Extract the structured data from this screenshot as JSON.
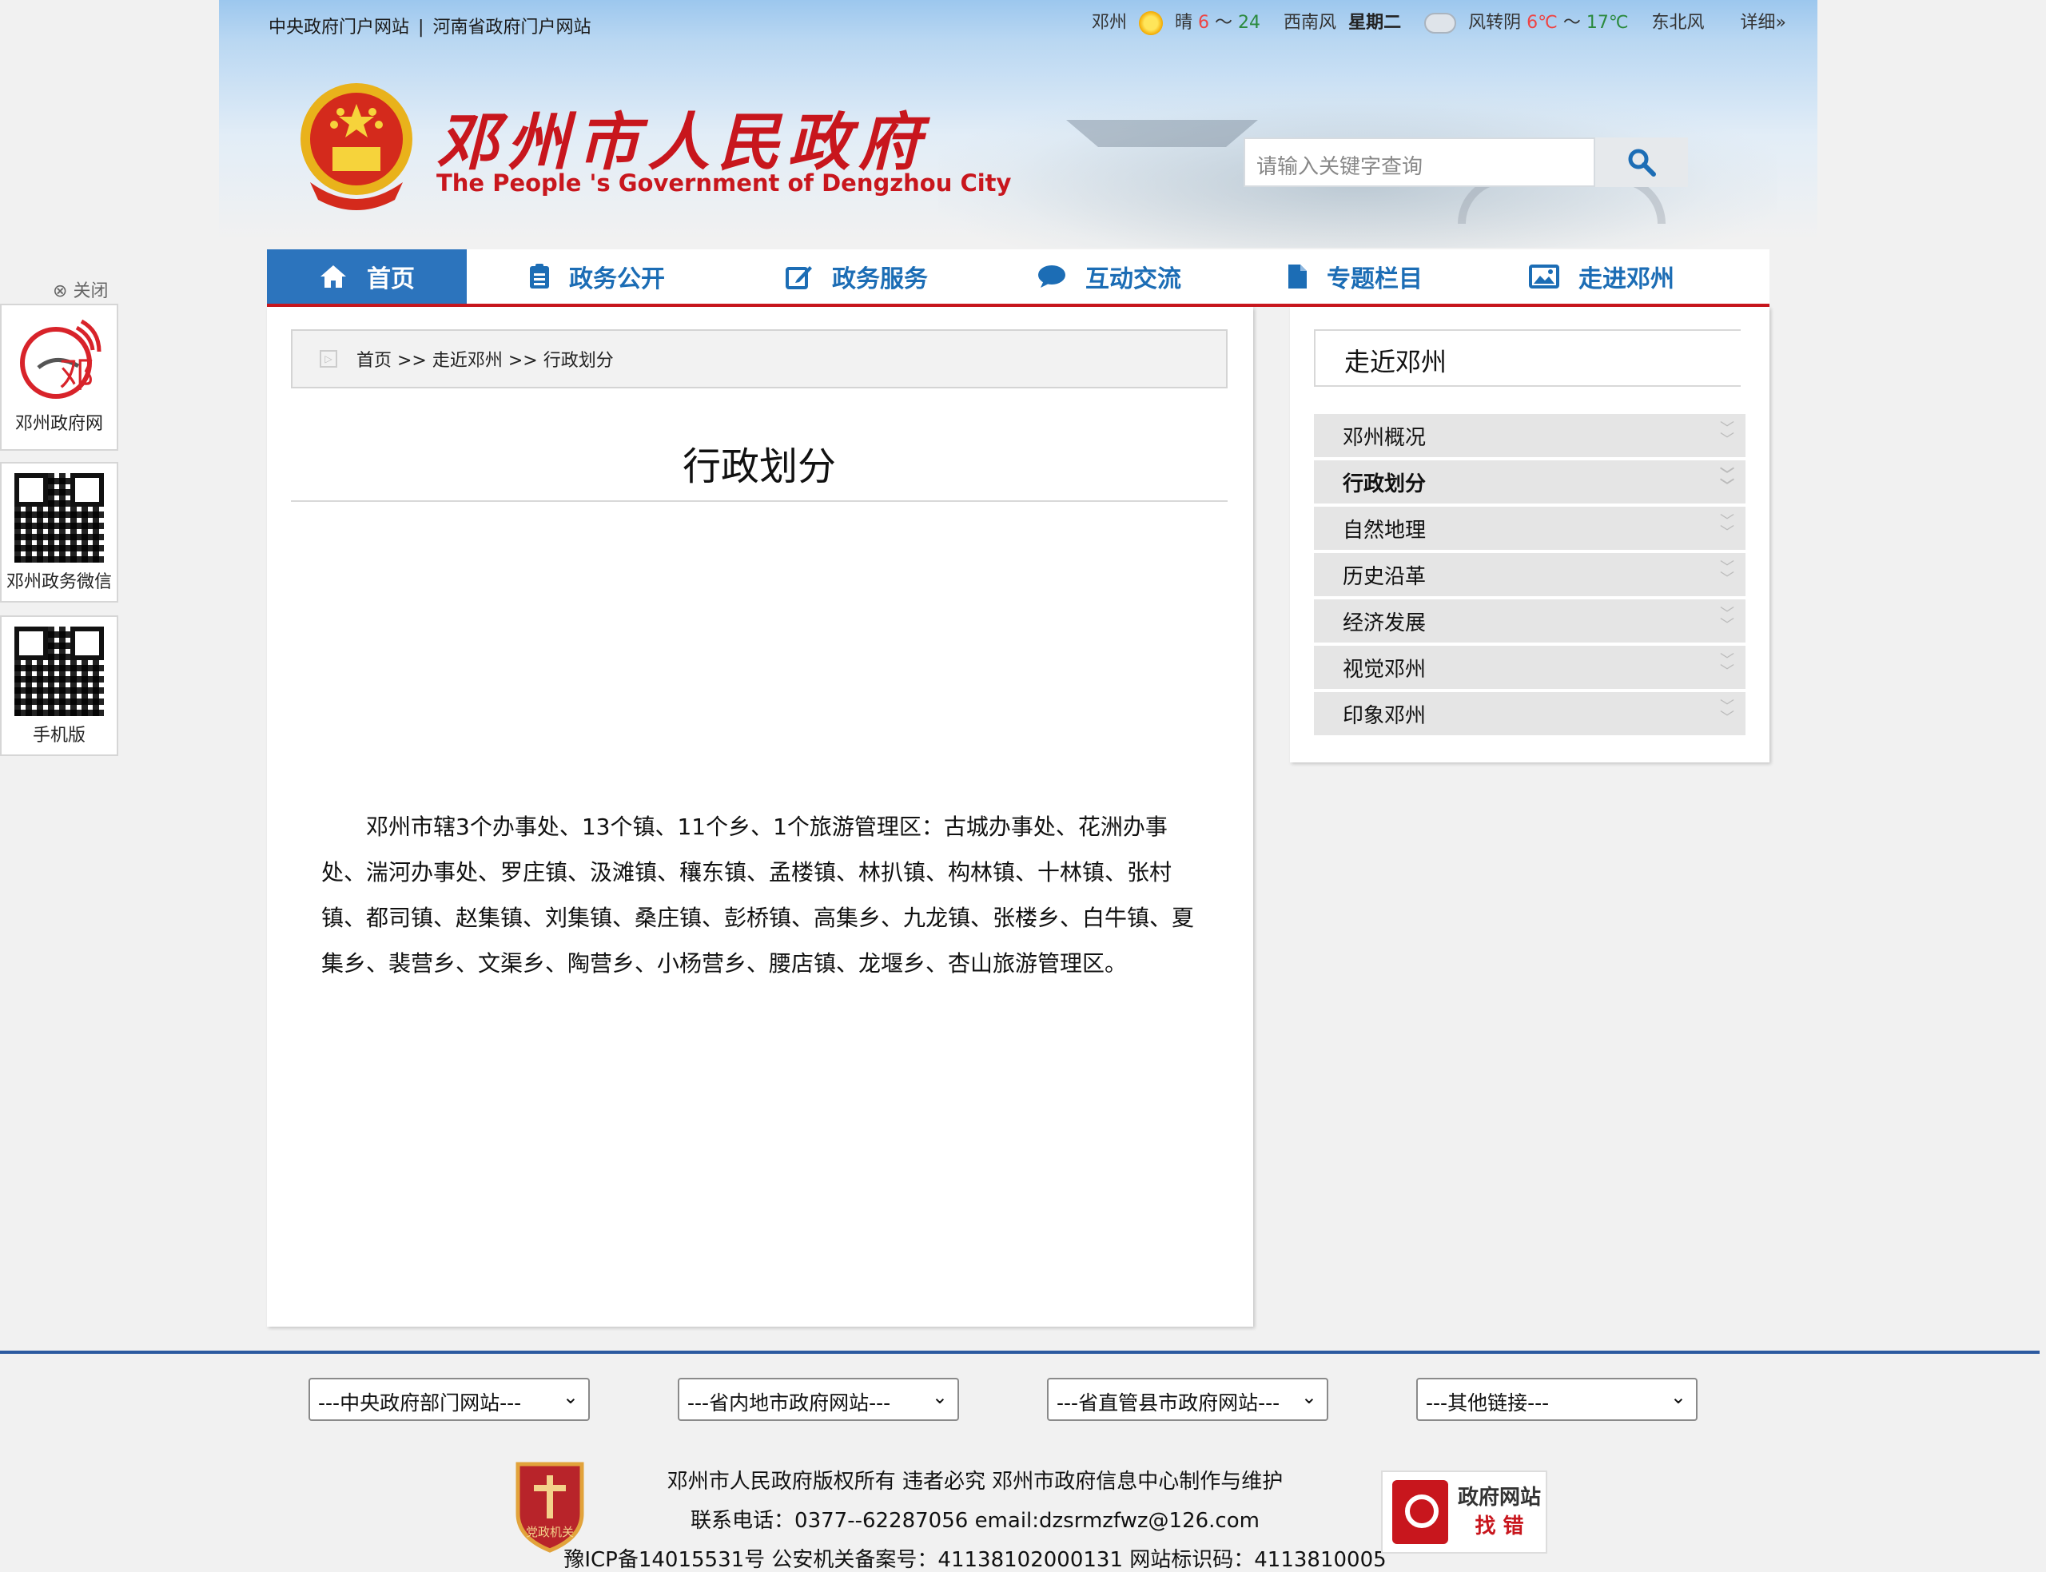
{
  "header": {
    "links": [
      "中央政府门户网站",
      "|",
      "河南省政府门户网站"
    ],
    "weather": {
      "city": "邓州",
      "today_sky": "晴",
      "today_lo": "6",
      "today_sep": "～",
      "today_hi": "24",
      "today_wind": "西南风",
      "weekday": "星期二",
      "tomorrow_sky": "风转阴",
      "tomorrow_lo": "6℃",
      "tomorrow_sep": "～",
      "tomorrow_hi": "17℃",
      "tomorrow_wind": "东北风",
      "more": "详细»"
    },
    "title": "邓州市人民政府",
    "subtitle": "The People 's Government of Dengzhou City",
    "search_placeholder": "请输入关键字查询"
  },
  "nav": {
    "items": [
      {
        "label": "首页",
        "icon": "home-icon"
      },
      {
        "label": "政务公开",
        "icon": "clipboard-icon"
      },
      {
        "label": "政务服务",
        "icon": "edit-icon"
      },
      {
        "label": "互动交流",
        "icon": "chat-icon"
      },
      {
        "label": "专题栏目",
        "icon": "document-icon"
      },
      {
        "label": "走进邓州",
        "icon": "picture-icon"
      }
    ]
  },
  "float": {
    "close": "关闭",
    "cards": [
      {
        "label": "邓州政府网",
        "logo_text": "邓"
      },
      {
        "label": "邓州政务微信"
      },
      {
        "label": "手机版"
      }
    ]
  },
  "main": {
    "breadcrumb": "首页 >> 走近邓州 >> 行政划分",
    "title": "行政划分",
    "body": "邓州市辖3个办事处、13个镇、11个乡、1个旅游管理区：古城办事处、花洲办事处、湍河办事处、罗庄镇、汲滩镇、穰东镇、孟楼镇、林扒镇、构林镇、十林镇、张村镇、都司镇、赵集镇、刘集镇、桑庄镇、彭桥镇、高集乡、九龙镇、张楼乡、白牛镇、夏集乡、裴营乡、文渠乡、陶营乡、小杨营乡、腰店镇、龙堰乡、杏山旅游管理区。"
  },
  "sidebar": {
    "heading": "走近邓州",
    "items": [
      "邓州概况",
      "行政划分",
      "自然地理",
      "历史沿革",
      "经济发展",
      "视觉邓州",
      "印象邓州"
    ],
    "active_index": 1
  },
  "footer": {
    "selects": [
      "---中央政府部门网站---",
      "---省内地市政府网站---",
      "---省直管县市政府网站---",
      "---其他链接---"
    ],
    "lines": [
      "邓州市人民政府版权所有 违者必究 邓州市政府信息中心制作与维护",
      "联系电话：0377--62287056 email:dzsrmzfwz@126.com",
      "豫ICP备14015531号 公安机关备案号：41138102000131 网站标识码：4113810005"
    ],
    "badge_left_text": "党政机关",
    "badge_right": [
      "政府网站",
      "找 错"
    ]
  },
  "colors": {
    "brand_red": "#c8161d",
    "nav_blue": "#1c6db5",
    "active_blue": "#2c74bd",
    "footer_rule": "#2c5aa0"
  }
}
